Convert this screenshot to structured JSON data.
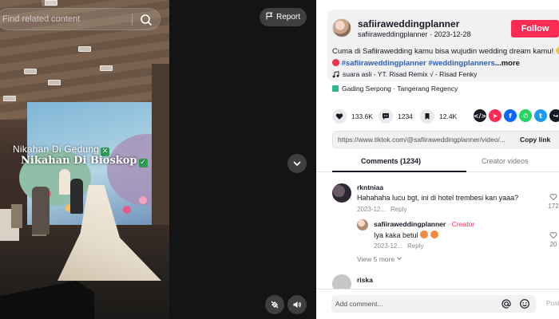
{
  "search": {
    "placeholder": "Find related content"
  },
  "video": {
    "caption_line1": "Nikahan Di Gedung",
    "caption_line2": "Nikahan Di Bioskop",
    "report_label": "Report"
  },
  "author": {
    "username": "safiiraweddingplanner",
    "handle": "safiiraweddingplanner",
    "date": "2023-12-28",
    "follow_label": "Follow"
  },
  "caption": {
    "text": "Cuma di Safiirawedding kamu bisa wujudin wedding dream kamu!",
    "tag1": "#safiiraweddingplanner",
    "tag2": "#weddingplanners",
    "more": "...more"
  },
  "music": {
    "text": "suara asli - YT. Risad Remix √ - Risad Fenky"
  },
  "location": {
    "text": "Gading Serpong · Tangerang Regency"
  },
  "stats": {
    "likes": "133.6K",
    "comments": "1234",
    "saves": "12.4K"
  },
  "link": {
    "url": "https://www.tiktok.com/@safiiraweddingplanner/video/...",
    "copy_label": "Copy link"
  },
  "tabs": {
    "comments": "Comments (1234)",
    "creator_videos": "Creator videos"
  },
  "comments": [
    {
      "user": "rkntniaa",
      "text": "Hahahaha lucu bgt, ini di hotel trembesi kan yaaa?",
      "date": "2023-12...",
      "reply": "Reply",
      "likes": "172"
    },
    {
      "user": "safiiraweddingplanner",
      "badge": "· Creator",
      "text": "Iya kaka betul",
      "date": "2023-12...",
      "reply": "Reply",
      "likes": "20"
    },
    {
      "user": "riska"
    }
  ],
  "view_more": "View 5 more",
  "add_comment": {
    "placeholder": "Add comment...",
    "post_label": "Post"
  },
  "colors": {
    "accent_red": "#fe2c55",
    "hashtag_blue": "#2b5db9",
    "text_dark": "#161823",
    "video_bg": "#141414",
    "panel_gray": "#f1f1f2"
  },
  "icons": {
    "search": "search-icon",
    "report": "flag-icon",
    "chevron": "chevron-down-icon",
    "mute": "volume-icon",
    "float": "floating-player-icon",
    "like": "heart-icon",
    "comment": "comment-icon",
    "save": "bookmark-icon",
    "music": "music-note-icon",
    "location": "location-icon",
    "mention": "at-icon",
    "emoji": "emoji-icon"
  }
}
